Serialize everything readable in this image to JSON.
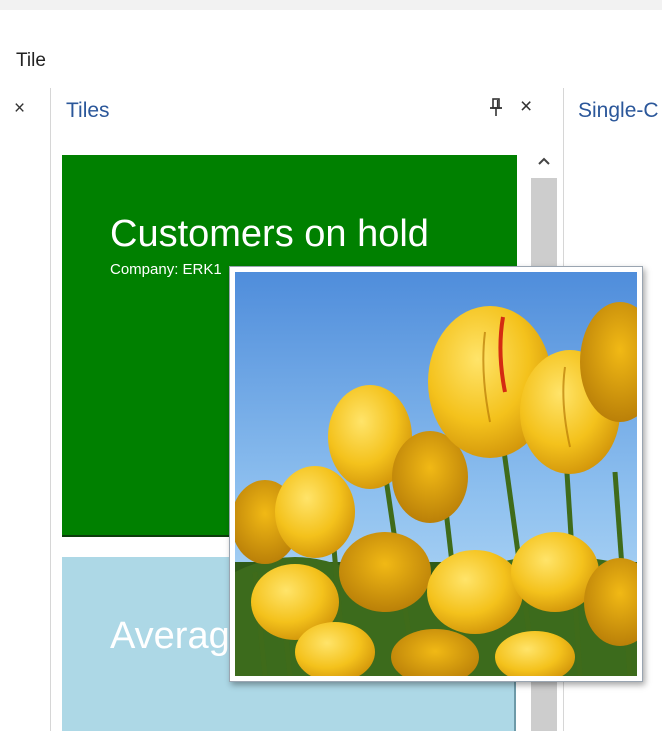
{
  "header": {
    "page_title": "Tile",
    "close_glyph": "×"
  },
  "pane": {
    "title": "Tiles",
    "pin_icon": "pin-icon",
    "close_glyph": "×"
  },
  "right_tab": {
    "label": "Single-C"
  },
  "tiles": [
    {
      "title": "Customers on hold",
      "subtitle": "Company: ER​K1",
      "color": "#008000"
    },
    {
      "title": "Average",
      "color": "#add8e6"
    }
  ],
  "scrollbar": {
    "up_icon": "chevron-up-icon"
  },
  "image_popup": {
    "subject": "yellow-tulips-image"
  }
}
